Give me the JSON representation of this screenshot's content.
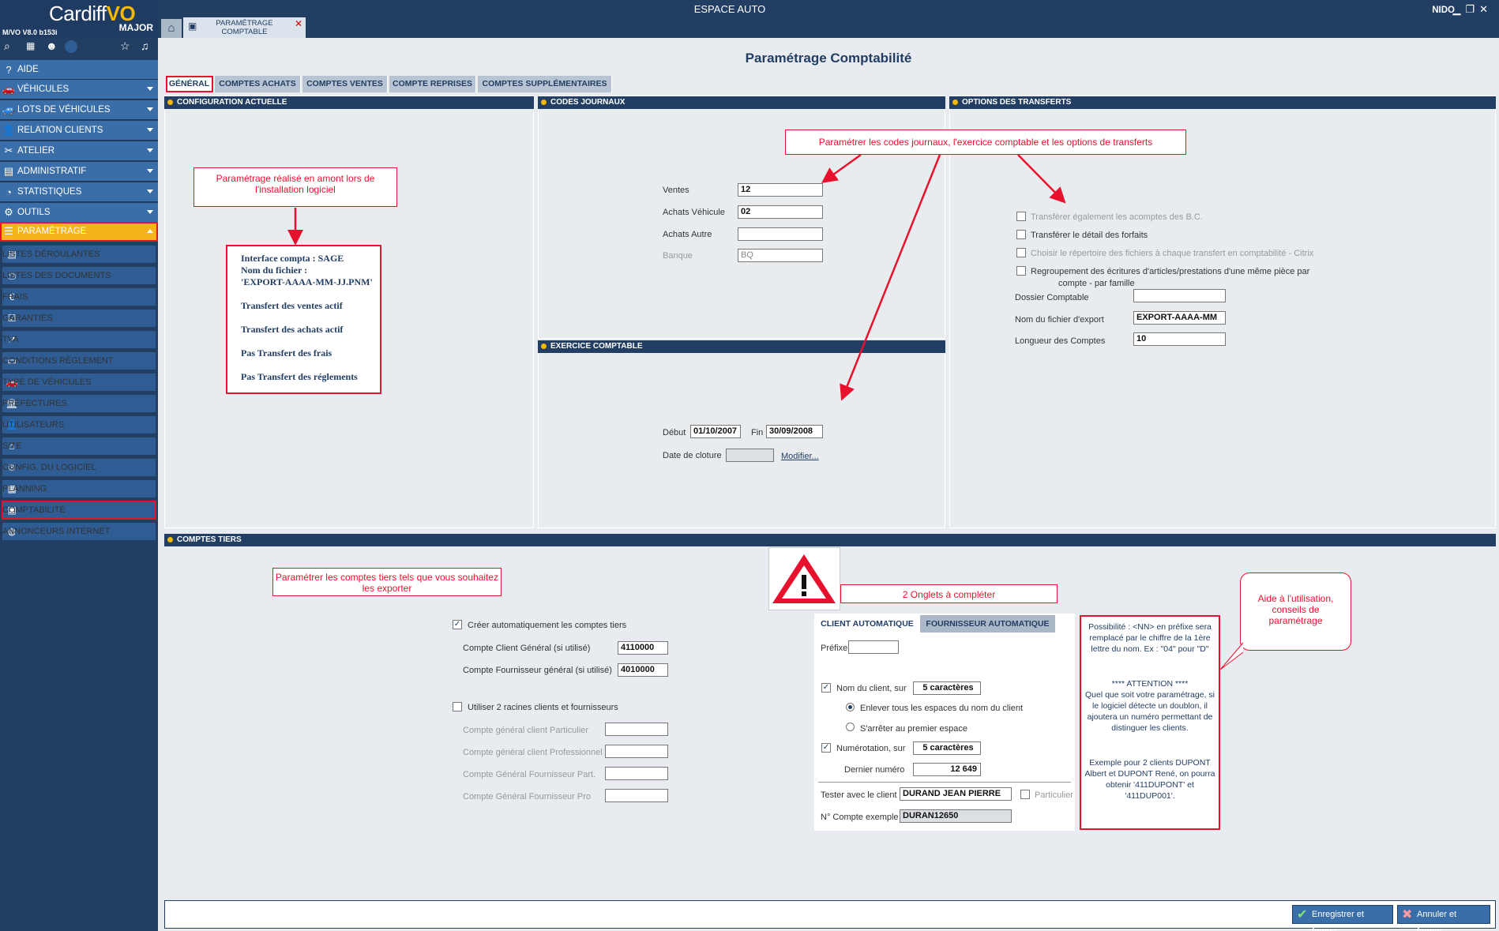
{
  "window": {
    "app_title": "ESPACE AUTO",
    "user": "NIDO",
    "minimize": "▁",
    "restore": "❐",
    "close": "✕"
  },
  "logo": {
    "brand": "Cardiff",
    "brand_accent": "VO",
    "edition": "MAJOR",
    "version": "M/VO V8.0 b153i"
  },
  "quickbar": {
    "search": "⌕",
    "calendar": "▦",
    "user": "☻",
    "favorite": "☆",
    "alerts": "♫"
  },
  "sidebar": {
    "main": [
      {
        "label": "AIDE",
        "icon": "?"
      },
      {
        "label": "VÉHICULES",
        "icon": "🚗"
      },
      {
        "label": "LOTS DE VÉHICULES",
        "icon": "🚙"
      },
      {
        "label": "RELATION CLIENTS",
        "icon": "👤"
      },
      {
        "label": "ATELIER",
        "icon": "✂"
      },
      {
        "label": "ADMINISTRATIF",
        "icon": "▤"
      },
      {
        "label": "STATISTIQUES",
        "icon": "◔"
      },
      {
        "label": "OUTILS",
        "icon": "⚙"
      },
      {
        "label": "PARAMÉTRAGE",
        "icon": "☰"
      }
    ],
    "sub": [
      {
        "label": "LISTES DÉROULANTES",
        "icon": "▤"
      },
      {
        "label": "LISTES DES DOCUMENTS",
        "icon": "⎙"
      },
      {
        "label": "FRAIS",
        "icon": "€"
      },
      {
        "label": "GARANTIES",
        "icon": "☑"
      },
      {
        "label": "TVA",
        "icon": "↗"
      },
      {
        "label": "CONDITIONS RÈGLEMENT",
        "icon": "▭"
      },
      {
        "label": "TYPE DE VÉHICULES",
        "icon": "🚗"
      },
      {
        "label": "PRÉFECTURES",
        "icon": "🏛"
      },
      {
        "label": "UTILISATEURS",
        "icon": "👤"
      },
      {
        "label": "SITE",
        "icon": "⌂"
      },
      {
        "label": "CONFIG. DU LOGICIEL",
        "icon": "⚙"
      },
      {
        "label": "PLANNING",
        "icon": "▦"
      },
      {
        "label": "COMPTABILITÉ",
        "icon": "▣"
      },
      {
        "label": "ANNONCEURS INTERNET",
        "icon": "◍"
      }
    ]
  },
  "doc_tab": {
    "line1": "PARAMÉTRAGE",
    "line2": "COMPTABLE",
    "close": "✕",
    "home": "⌂",
    "icon": "▣"
  },
  "page": {
    "title": "Paramétrage Comptabilité",
    "tabs": [
      "GÉNÉRAL",
      "COMPTES ACHATS",
      "COMPTES VENTES",
      "COMPTE REPRISES",
      "COMPTES SUPPLÉMENTAIRES"
    ]
  },
  "config": {
    "header": "CONFIGURATION ACTUELLE",
    "note": "Paramétrage réalisé en amont lors de l'installation logiciel",
    "lines": [
      "Interface compta : SAGE",
      "Nom du fichier :",
      "'EXPORT-AAAA-MM-JJ.PNM'",
      "Transfert des ventes actif",
      "Transfert des achats actif",
      "Pas Transfert des frais",
      "Pas Transfert des réglements"
    ]
  },
  "journaux": {
    "header": "CODES JOURNAUX",
    "note": "Paramétrer les codes journaux, l'exercice comptable et les options de transferts",
    "ventes_label": "Ventes",
    "ventes": "12",
    "achats_veh_label": "Achats Véhicule",
    "achats_veh": "02",
    "achats_autre_label": "Achats Autre",
    "achats_autre": "",
    "banque_label": "Banque",
    "banque": "BQ"
  },
  "exercice": {
    "header": "EXERCICE COMPTABLE",
    "debut_label": "Début",
    "debut": "01/10/2007",
    "fin_label": "Fin",
    "fin": "30/09/2008",
    "cloture_label": "Date de cloture",
    "cloture": "",
    "modifier": "Modifier..."
  },
  "transferts": {
    "header": "OPTIONS DES TRANSFERTS",
    "opt1": "Transférer également les acomptes des B.C.",
    "opt2": "Transférer le détail des forfaits",
    "opt3": "Choisir le répertoire des fichiers à chaque transfert en comptabilité - Citrix",
    "opt4a": "Regroupement des écritures d'articles/prestations d'une même pièce par",
    "opt4b": "compte - par famille",
    "dossier_label": "Dossier Comptable",
    "dossier": "",
    "fichier_label": "Nom du fichier d'export",
    "fichier": "EXPORT-AAAA-MM",
    "longueur_label": "Longueur des Comptes",
    "longueur": "10"
  },
  "tiers": {
    "header": "COMPTES TIERS",
    "note": "Paramétrer les comptes tiers tels que vous souhaitez les exporter",
    "warning_note": "2 Onglets à compléter",
    "auto_label": "Créer automatiquement les comptes tiers",
    "check_mark": "✓",
    "client_gen_label": "Compte Client Général (si utilisé)",
    "client_gen": "4110000",
    "fourn_gen_label": "Compte Fournisseur général (si utilisé)",
    "fourn_gen": "4010000",
    "racines_label": "Utiliser 2 racines clients et fournisseurs",
    "cg_part_label": "Compte général client Particulier",
    "cg_pro_label": "Compte général client Professionnel",
    "cf_part_label": "Compte Général Fournisseur Part.",
    "cf_pro_label": "Compte Général Fournisseur Pro",
    "subtabs": [
      "CLIENT AUTOMATIQUE",
      "FOURNISSEUR AUTOMATIQUE"
    ],
    "prefixe_label": "Préfixe",
    "prefixe": "",
    "nom_label": "Nom du client, sur",
    "nom_val": "5 caractères",
    "radio1": "Enlever tous les espaces du nom du client",
    "radio2": "S'arrêter au premier espace",
    "num_label": "Numérotation, sur",
    "num_val": "5 caractères",
    "dernier_label": "Dernier numéro",
    "dernier": "12 649",
    "tester_label": "Tester avec le client",
    "tester": "DURAND JEAN PIERRE",
    "particulier_label": "Particulier",
    "exemple_label": "N° Compte exemple",
    "exemple": "DURAN12650"
  },
  "help": {
    "bubble": "Aide à l'utilisation, conseils de paramétrage",
    "p1": "Possibilité : <NN> en préfixe sera remplacé par le chiffre de la 1ère lettre du nom. Ex : \"04\" pour \"D\"",
    "p2": "**** ATTENTION ****",
    "p3": "Quel que soit votre paramétrage, si le logiciel détecte un doublon, il ajoutera un numéro permettant de distinguer les clients.",
    "p4": "Exemple pour 2 clients DUPONT Albert et DUPONT René, on pourra obtenir '411DUPONT' et '411DUP001'."
  },
  "footer": {
    "save": "Enregistrer et fermer",
    "cancel": "Annuler et fermer"
  },
  "colors": {
    "navy": "#223e63",
    "accent": "#f5b800",
    "annotation": "#e8112d",
    "nav": "#3a6ea8"
  }
}
